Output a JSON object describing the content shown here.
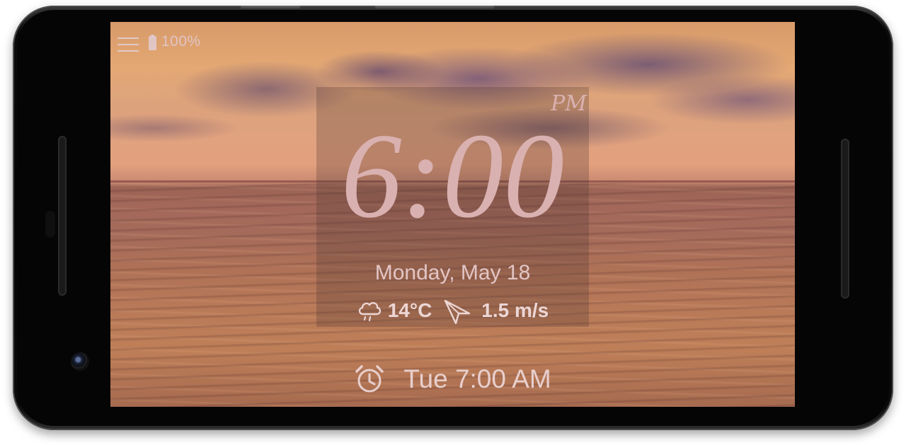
{
  "status_bar": {
    "battery_level": "100%"
  },
  "clock": {
    "time": "6:00",
    "period": "PM",
    "date": "Monday, May 18"
  },
  "weather": {
    "condition_icon": "cloud-rain-icon",
    "temperature": "14°C",
    "wind_icon": "wind-direction-arrow-icon",
    "wind_speed": "1.5 m/s"
  },
  "next_alarm": {
    "icon": "alarm-clock-icon",
    "label": "Tue 7:00 AM"
  },
  "colors": {
    "clock_text": "#d9b1b0",
    "secondary_text": "#e2c5c4",
    "phone_body": "#050505"
  }
}
